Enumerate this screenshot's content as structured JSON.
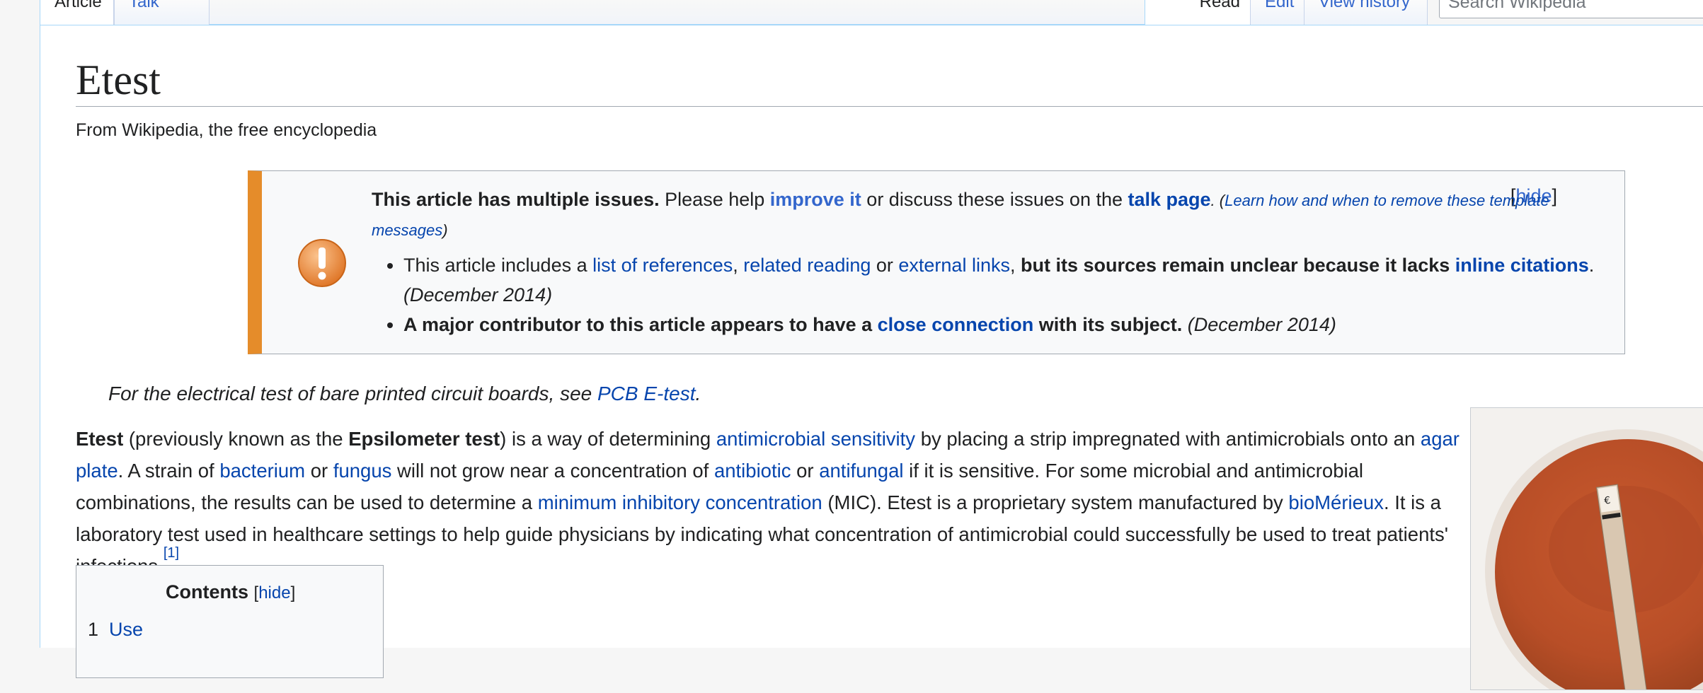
{
  "tabs": {
    "article": "Article",
    "talk": "Talk",
    "read": "Read",
    "edit": "Edit",
    "history": "View history",
    "search_placeholder": "Search Wikipedia"
  },
  "page": {
    "title": "Etest",
    "tagline": "From Wikipedia, the free encyclopedia"
  },
  "issues": {
    "lead_bold": "This article has multiple issues.",
    "lead_text": " Please help ",
    "improve": "improve it",
    "or_discuss": " or discuss these issues on the ",
    "talk_page": "talk page",
    "dot": ". (",
    "learn": "Learn how and when to remove these template messages",
    "close_paren": ")",
    "hide": "hide",
    "item1": {
      "t1": "This article includes a ",
      "l1": "list of references",
      "t2": ", ",
      "l2": "related reading",
      "t3": " or ",
      "l3": "external links",
      "t4": ", ",
      "bold": "but its sources remain unclear because it lacks ",
      "l4": "inline citations",
      "t5": ". ",
      "date": "(December 2014)"
    },
    "item2": {
      "bold1": "A major contributor to this article appears to have a ",
      "link": "close connection",
      "bold2": " with its subject.",
      "date": "(December 2014)"
    }
  },
  "hatnote": {
    "text": "For the electrical test of bare printed circuit boards, see ",
    "link": "PCB E-test",
    "end": "."
  },
  "paragraph": {
    "b1": "Etest",
    "t1": " (previously known as the ",
    "b2": "Epsilometer test",
    "t2": ") is a way of determining ",
    "l1": "antimicrobial sensitivity",
    "t3": " by placing a strip impregnated with antimicrobials onto an ",
    "l2": "agar plate",
    "t4": ". A strain of ",
    "l3": "bacterium",
    "t5": " or ",
    "l4": "fungus",
    "t6": " will not grow near a concentration of ",
    "l5": "antibiotic",
    "t7": " or ",
    "l6": "antifungal",
    "t8": " if it is sensitive. For some microbial and antimicrobial combinations, the results can be used to determine a ",
    "l7": "minimum inhibitory concentration",
    "t9": " (MIC). Etest is a proprietary system manufactured by ",
    "l8": "bioMérieux",
    "t10": ". It is a laboratory test used in healthcare settings to help guide physicians by indicating what concentration of antimicrobial could successfully be used to treat patients' infections.",
    "ref": "[1]"
  },
  "toc": {
    "title": "Contents",
    "hide": "hide",
    "items": [
      {
        "num": "1",
        "label": "Use"
      }
    ]
  },
  "colors": {
    "link": "#3366cc",
    "notice_bar": "#e58c2a"
  }
}
